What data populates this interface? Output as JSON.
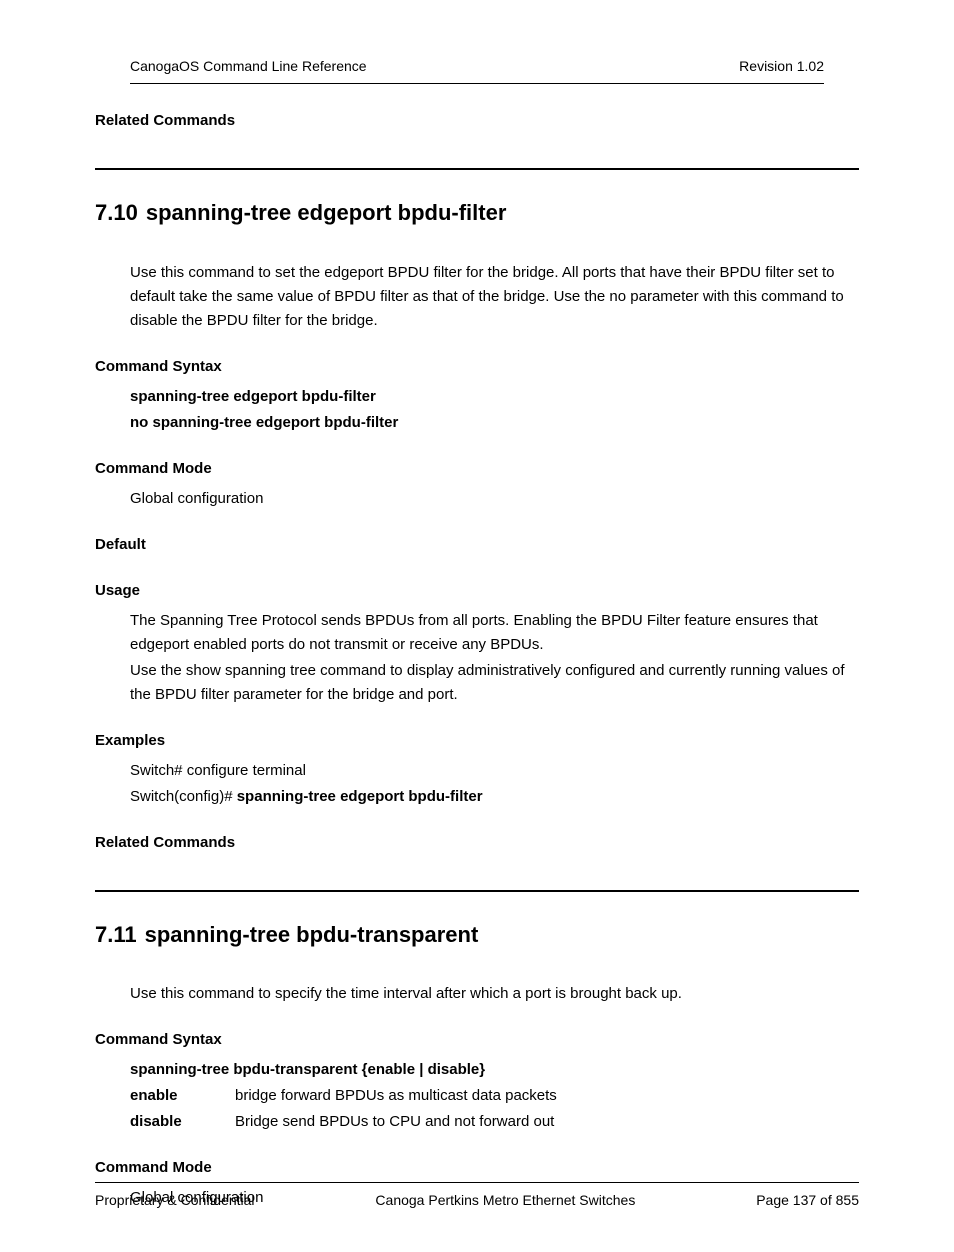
{
  "header": {
    "left": "CanogaOS Command Line Reference",
    "right": "Revision 1.02"
  },
  "related_commands_top": "Related Commands",
  "section_710": {
    "number": "7.10",
    "title": "spanning-tree edgeport bpdu-filter",
    "intro": "Use this command to set the edgeport BPDU filter for the bridge. All ports that have their BPDU filter set to default take the same value of BPDU filter as that of the bridge. Use the no parameter with this command to disable the BPDU filter for the bridge.",
    "command_syntax_label": "Command Syntax",
    "syntax_line1": "spanning-tree edgeport bpdu-filter",
    "syntax_line2": "no spanning-tree edgeport bpdu-filter",
    "command_mode_label": "Command Mode",
    "command_mode_value": "Global configuration",
    "default_label": "Default",
    "usage_label": "Usage",
    "usage_p1": "The Spanning Tree Protocol sends BPDUs from all ports. Enabling the BPDU Filter feature ensures that edgeport enabled ports do not transmit or receive any BPDUs.",
    "usage_p2": "Use the show spanning tree command to display administratively configured and currently running values of the BPDU filter parameter for the bridge and port.",
    "examples_label": "Examples",
    "example_line1": "Switch# configure terminal",
    "example_line2_prefix": "Switch(config)# ",
    "example_line2_bold": "spanning-tree edgeport bpdu-filter",
    "related_commands_label": "Related Commands"
  },
  "section_711": {
    "number": "7.11",
    "title": "spanning-tree bpdu-transparent",
    "intro": "Use this command to specify the time interval after which a port is brought back up.",
    "command_syntax_label": "Command Syntax",
    "syntax_line": "spanning-tree bpdu-transparent {enable | disable}",
    "params": [
      {
        "key": "enable",
        "val": "bridge forward BPDUs as multicast data packets"
      },
      {
        "key": "disable",
        "val": "Bridge send BPDUs to CPU and not forward out"
      }
    ],
    "command_mode_label": "Command Mode",
    "command_mode_value": "Global configuration"
  },
  "footer": {
    "left": "Proprietary & Confidential",
    "center": "Canoga Pertkins Metro Ethernet Switches",
    "right": "Page 137 of 855"
  }
}
